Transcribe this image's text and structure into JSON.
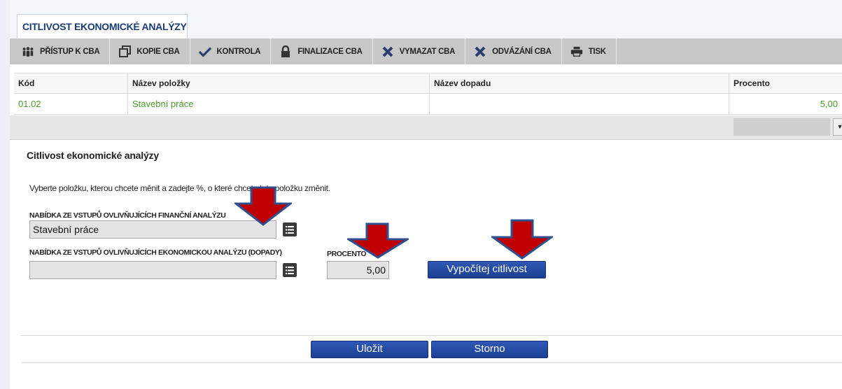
{
  "tab": {
    "title": "CITLIVOST EKONOMICKÉ ANALÝZY"
  },
  "toolbar": {
    "items": [
      {
        "label": "PŘÍSTUP K CBA",
        "icon": "people-icon"
      },
      {
        "label": "KOPIE CBA",
        "icon": "copy-icon"
      },
      {
        "label": "KONTROLA",
        "icon": "check-icon"
      },
      {
        "label": "FINALIZACE CBA",
        "icon": "lock-icon"
      },
      {
        "label": "VYMAZAT CBA",
        "icon": "cross-icon"
      },
      {
        "label": "ODVÁZÁNÍ CBA",
        "icon": "cross-icon"
      },
      {
        "label": "TISK",
        "icon": "printer-icon"
      }
    ]
  },
  "table": {
    "headers": [
      "Kód",
      "Název položky",
      "Název dopadu",
      "Procento"
    ],
    "rows": [
      {
        "kod": "01.02",
        "nazev": "Stavební práce",
        "dopad": "",
        "procento": "5,00"
      }
    ]
  },
  "form": {
    "title": "Citlivost ekonomické analýzy",
    "instruction": "Vyberte položku, kterou chcete měnit a zadejte %, o které chcete tuto položku změnit.",
    "financial_label": "NABÍDKA ZE VSTUPŮ OVLIVŇUJÍCÍCH FINANČNÍ ANALÝZU",
    "financial_value": "Stavební práce",
    "economic_label": "NABÍDKA ZE VSTUPŮ OVLIVŇUJÍCÍCH EKONOMICKOU ANALÝZU (DOPADY)",
    "economic_value": "",
    "percent_label": "PROCENTO",
    "percent_value": "5,00",
    "calculate_button": "Vypočítej citlivost",
    "save_button": "Uložit",
    "cancel_button": "Storno"
  },
  "colors": {
    "accent_blue": "#1d3f92",
    "link_green": "#4e9a2e",
    "toolbar_gray": "#c7c7c7",
    "arrow_red": "#c00000",
    "arrow_outline": "#2f4f8f"
  }
}
